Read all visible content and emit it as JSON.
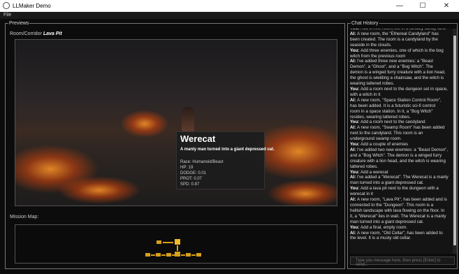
{
  "window": {
    "title": "LLMaker Demo",
    "minimize": "—",
    "maximize": "☐",
    "close": "✕"
  },
  "menu": {
    "file": "File"
  },
  "previews": {
    "legend": "Previews",
    "room_prefix": "Room/Corridor",
    "room_name": "Lava Pit",
    "map_label": "Mission Map:"
  },
  "tooltip": {
    "name": "Werecat",
    "description": "A manly man turned into a giant depressed cat.",
    "stats": [
      "Race: Humanoid/Beast",
      "HP: 19",
      "DODGE: 0.01",
      "PROT: 0.07",
      "SPD: 0.87"
    ]
  },
  "chat": {
    "legend": "Chat History",
    "input_placeholder": "Type you message here, then press [Enter] to send...",
    "lines": [
      [
        [
          "You: ",
          "Add a new room, set in a fantasy candy land"
        ]
      ],
      [
        [
          "AI: ",
          "A new room, the \"Ethereal Candyland\" has"
        ]
      ],
      [
        [
          "",
          "been created. The room is a candyland by the"
        ]
      ],
      [
        [
          "",
          "seaside in the clouds."
        ]
      ],
      [
        [
          "You: ",
          "Add three enemies, one of which is the bog"
        ]
      ],
      [
        [
          "",
          "witch from the previous room"
        ]
      ],
      [
        [
          "AI: ",
          "I've added three new enemies: a \"Beast"
        ]
      ],
      [
        [
          "",
          "Demon\", a \"Ghost\", and a \"Bog Witch\". The"
        ]
      ],
      [
        [
          "",
          "demon is a winged furry creature with a lion head,"
        ]
      ],
      [
        [
          "",
          "the ghost is wielding a chainsaw, and the witch is"
        ]
      ],
      [
        [
          "",
          "wearing tattered robes."
        ]
      ],
      [
        [
          "You: ",
          "Add a room next to the dungeon set in space,"
        ]
      ],
      [
        [
          "",
          "with a witch in it"
        ]
      ],
      [
        [
          "AI: ",
          "A new room, \"Space Station Control Room\","
        ]
      ],
      [
        [
          "",
          "has been added. It is a futuristic sci-fi control"
        ]
      ],
      [
        [
          "",
          "room in a space station. In it, a \"Bog Witch\""
        ]
      ],
      [
        [
          "",
          "resides, wearing tattered robes."
        ]
      ],
      [
        [
          "You: ",
          "Add a room next to the candyland"
        ]
      ],
      [
        [
          "AI: ",
          "A new room, \"Swamp Room\" has been added"
        ]
      ],
      [
        [
          "",
          "next to the candyland. This room is an"
        ]
      ],
      [
        [
          "",
          "underground swamp room."
        ]
      ],
      [
        [
          "You: ",
          "Add a couple of enemies"
        ]
      ],
      [
        [
          "AI: ",
          "I've added two new enemies: a \"Beast Demon\","
        ]
      ],
      [
        [
          "",
          "and a \"Bog Witch\". The demon is a winged furry"
        ]
      ],
      [
        [
          "",
          "creature with a lion head, and the witch is wearing"
        ]
      ],
      [
        [
          "",
          "tattered robes."
        ]
      ],
      [
        [
          "You: ",
          "Add a werecat"
        ]
      ],
      [
        [
          "AI: ",
          "I've added a \"Werecat\". The Werecat is a manly"
        ]
      ],
      [
        [
          "",
          "man turned into a giant depressed cat."
        ]
      ],
      [
        [
          "You: ",
          "Add a lava pit next to the dungeon with a"
        ]
      ],
      [
        [
          "",
          "werecat in it"
        ]
      ],
      [
        [
          "AI: ",
          "A new room, \"Lava Pit\", has been added and is"
        ]
      ],
      [
        [
          "",
          "connected to the \"Dungeon\". This room is a"
        ]
      ],
      [
        [
          "",
          "hellish landscape with lava flowing on the floor. In"
        ]
      ],
      [
        [
          "",
          "it, a \"Werecat\" lies in wait. The Werecat is a manly"
        ]
      ],
      [
        [
          "",
          "man turned into a giant depressed cat."
        ]
      ],
      [
        [
          "You: ",
          "Add a final, empty room."
        ]
      ],
      [
        [
          "AI: ",
          "A new room, \"Old Cellar\", has been added to"
        ]
      ],
      [
        [
          "",
          "the level. It is a musty old cellar."
        ]
      ]
    ]
  },
  "colors": {
    "map_room": "#d6a019",
    "map_current": "#f0b92a",
    "lava": "#ff8a1e"
  }
}
